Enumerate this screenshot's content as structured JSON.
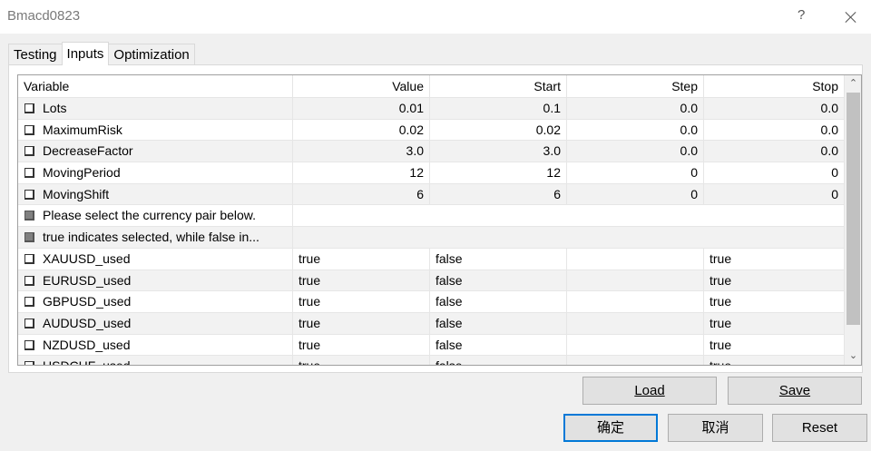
{
  "window": {
    "title": "Bmacd0823",
    "help": "?"
  },
  "tabs": [
    "Testing",
    "Inputs",
    "Optimization"
  ],
  "table": {
    "headers": [
      "Variable",
      "Value",
      "Start",
      "Step",
      "Stop"
    ],
    "rows": [
      {
        "name": "Lots",
        "value": "0.01",
        "start": "0.1",
        "step": "0.0",
        "stop": "0.0"
      },
      {
        "name": "MaximumRisk",
        "value": "0.02",
        "start": "0.02",
        "step": "0.0",
        "stop": "0.0"
      },
      {
        "name": "DecreaseFactor",
        "value": "3.0",
        "start": "3.0",
        "step": "0.0",
        "stop": "0.0"
      },
      {
        "name": "MovingPeriod",
        "value": "12",
        "start": "12",
        "step": "0",
        "stop": "0"
      },
      {
        "name": "MovingShift",
        "value": "6",
        "start": "6",
        "step": "0",
        "stop": "0"
      },
      {
        "name": "Please select the currency pair below.",
        "value": "",
        "start": "",
        "step": "",
        "stop": ""
      },
      {
        "name": "true indicates selected, while false in...",
        "value": "",
        "start": "",
        "step": "",
        "stop": ""
      },
      {
        "name": "XAUUSD_used",
        "value": "true",
        "start": "false",
        "step": "",
        "stop": "true"
      },
      {
        "name": "EURUSD_used",
        "value": "true",
        "start": "false",
        "step": "",
        "stop": "true"
      },
      {
        "name": "GBPUSD_used",
        "value": "true",
        "start": "false",
        "step": "",
        "stop": "true"
      },
      {
        "name": "AUDUSD_used",
        "value": "true",
        "start": "false",
        "step": "",
        "stop": "true"
      },
      {
        "name": "NZDUSD_used",
        "value": "true",
        "start": "false",
        "step": "",
        "stop": "true"
      },
      {
        "name": "USDCHF_used",
        "value": "true",
        "start": "false",
        "step": "",
        "stop": "true"
      }
    ]
  },
  "buttons": {
    "load": "Load",
    "save": "Save",
    "ok": "确定",
    "cancel": "取消",
    "reset": "Reset"
  }
}
